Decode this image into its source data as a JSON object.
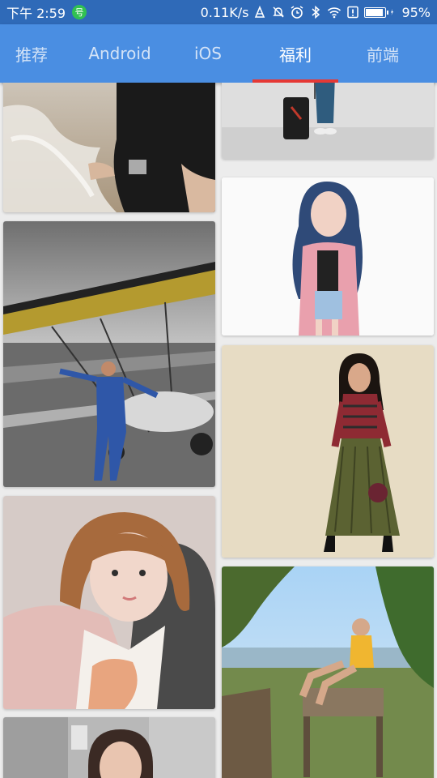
{
  "status_bar": {
    "time": "下午 2:59",
    "app_badge": "号",
    "speed": "0.11K/s",
    "icons": [
      "data-icon",
      "mute-icon",
      "alarm-icon",
      "bluetooth-icon",
      "wifi-icon",
      "alert-icon",
      "battery-icon"
    ],
    "battery_text": "95%",
    "battery_level": 0.95
  },
  "tabs": [
    {
      "label": "推荐"
    },
    {
      "label": "Android"
    },
    {
      "label": "iOS"
    },
    {
      "label": "福利",
      "active": true
    },
    {
      "label": "前端"
    }
  ],
  "colors": {
    "status_bar": "#2f6ab8",
    "tab_bar": "#4a8ee2",
    "tab_indicator": "#e53935",
    "background": "#ececec"
  },
  "photos": {
    "left": [
      {
        "subject": "person in black t-shirt on beach"
      },
      {
        "subject": "woman in blue flight suit beside ultralight aircraft"
      },
      {
        "subject": "woman with short brown hair"
      },
      {
        "subject": "woman in elevator"
      }
    ],
    "right": [
      {
        "subject": "person with luggage"
      },
      {
        "subject": "woman with blue curly hair"
      },
      {
        "subject": "woman in striped top and green pleated skirt"
      },
      {
        "subject": "woman sitting on chair outdoors by the sea"
      }
    ]
  }
}
